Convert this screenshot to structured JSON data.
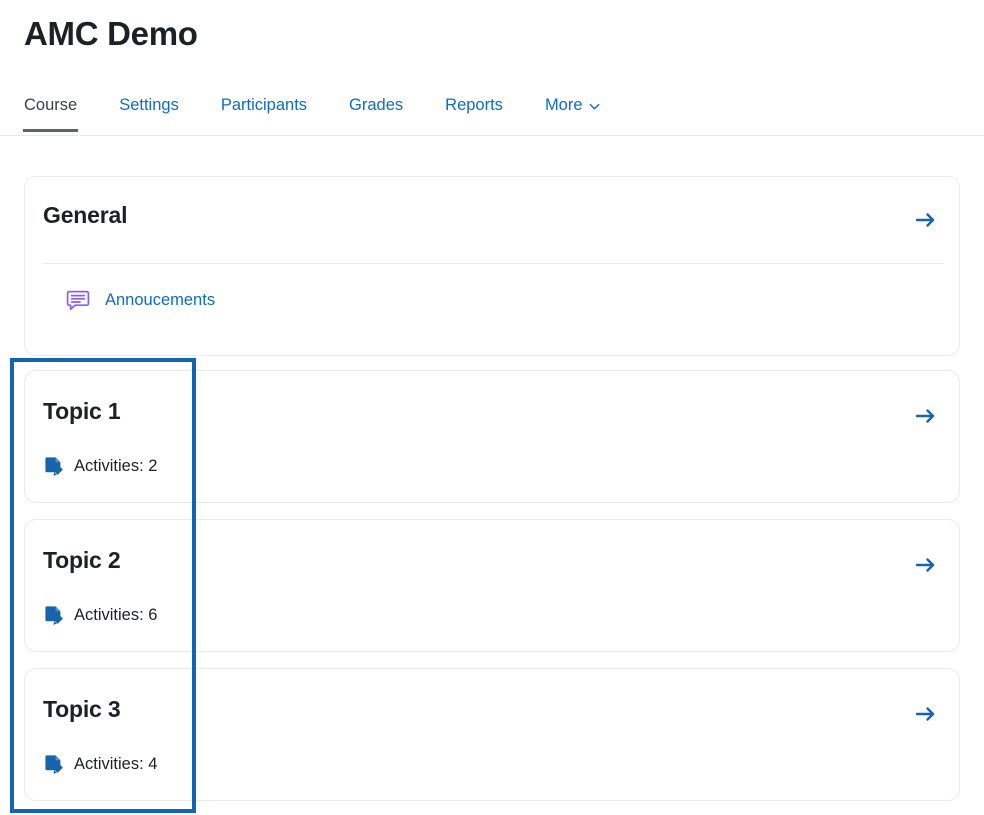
{
  "header": {
    "course_title": "AMC Demo"
  },
  "nav": {
    "tabs": [
      {
        "label": "Course",
        "active": true,
        "has_chevron": false
      },
      {
        "label": "Settings",
        "active": false,
        "has_chevron": false
      },
      {
        "label": "Participants",
        "active": false,
        "has_chevron": false
      },
      {
        "label": "Grades",
        "active": false,
        "has_chevron": false
      },
      {
        "label": "Reports",
        "active": false,
        "has_chevron": false
      },
      {
        "label": "More",
        "active": false,
        "has_chevron": true
      }
    ],
    "more_chevron_icon": "chevron-down-icon"
  },
  "sections": {
    "general": {
      "title": "General",
      "arrow_icon": "arrow-right-icon",
      "activities": [
        {
          "name": "Annoucements",
          "icon": "forum-icon",
          "icon_color": "#8b5cf6"
        }
      ]
    },
    "topics": [
      {
        "title": "Topic 1",
        "summary": "Activities: 2",
        "summary_icon": "assignment-icon",
        "arrow_icon": "arrow-right-icon",
        "highlighted": true
      },
      {
        "title": "Topic 2",
        "summary": "Activities: 6",
        "summary_icon": "assignment-icon",
        "arrow_icon": "arrow-right-icon",
        "highlighted": true
      },
      {
        "title": "Topic 3",
        "summary": "Activities: 4",
        "summary_icon": "assignment-icon",
        "arrow_icon": "arrow-right-icon",
        "highlighted": true
      }
    ]
  },
  "annotation": {
    "highlight_border_color": "#1464b4"
  },
  "colors": {
    "link": "#0f6cbf",
    "arrow": "#1864ab",
    "heading": "#1d2125",
    "active_tab_underline": "#5d6469",
    "card_border": "#e9eaeb",
    "forum_icon": "#8b5cf6",
    "assignment_icon": "#1864ab"
  }
}
